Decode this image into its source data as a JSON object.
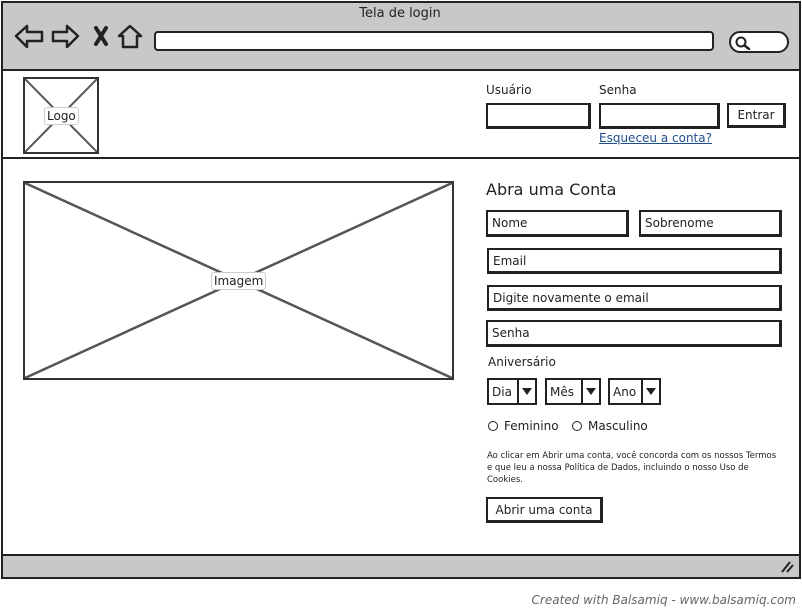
{
  "window": {
    "title": "Tela de login",
    "nav_icons": [
      "back-arrow-icon",
      "forward-arrow-icon",
      "close-x-icon",
      "home-icon"
    ],
    "search_icon": "search-icon",
    "url_value": ""
  },
  "header": {
    "logo_label": "Logo",
    "username_label": "Usuário",
    "password_label": "Senha",
    "username_value": "",
    "password_value": "",
    "login_button": "Entrar",
    "forgot_link": "Esqueceu a conta?"
  },
  "main": {
    "image_label": "Imagem"
  },
  "signup": {
    "title": "Abra uma Conta",
    "first_name": "Nome",
    "last_name": "Sobrenome",
    "email": "Email",
    "email_confirm": "Digite novamente o email",
    "password": "Senha",
    "birthday_label": "Aniversário",
    "day": "Dia",
    "month": "Mês",
    "year": "Ano",
    "gender_female": "Feminino",
    "gender_male": "Masculino",
    "terms": "Ao clicar em Abrir uma conta, você concorda com os nossos Termos e que leu a nossa Política de Dados, incluindo o nosso Uso de Cookies.",
    "submit_button": "Abrir uma conta"
  },
  "footer": {
    "credit": "Created with Balsamiq - www.balsamiq.com"
  },
  "colors": {
    "chrome": "#c8c8c8",
    "link": "#1f4e8c",
    "stroke": "#222222"
  }
}
